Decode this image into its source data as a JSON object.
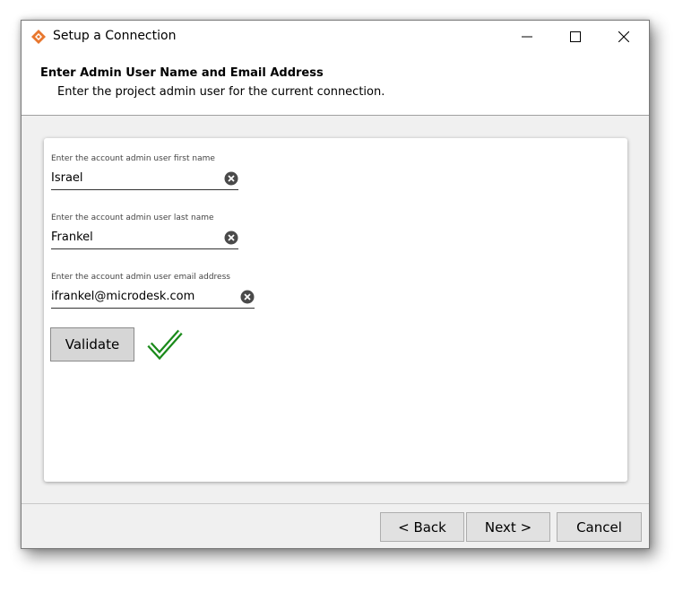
{
  "window": {
    "title": "Setup a Connection",
    "controls": {
      "minimize_icon": "minimize-icon",
      "maximize_icon": "maximize-icon",
      "close_icon": "close-icon"
    }
  },
  "header": {
    "title": "Enter Admin User Name and Email Address",
    "subtitle": "Enter the project admin user for the current connection."
  },
  "form": {
    "fields": [
      {
        "label": "Enter the account admin user first name",
        "value": "Israel"
      },
      {
        "label": "Enter the account admin user last name",
        "value": "Frankel"
      },
      {
        "label": "Enter the account admin user email address",
        "value": "ifrankel@microdesk.com"
      }
    ],
    "validate_label": "Validate",
    "validation_status": "valid"
  },
  "footer": {
    "back_label": "< Back",
    "next_label": "Next >",
    "cancel_label": "Cancel"
  },
  "colors": {
    "app_icon_orange": "#e8772e",
    "check_green": "#1a8a1a",
    "clear_icon": "#4a4a4a"
  }
}
